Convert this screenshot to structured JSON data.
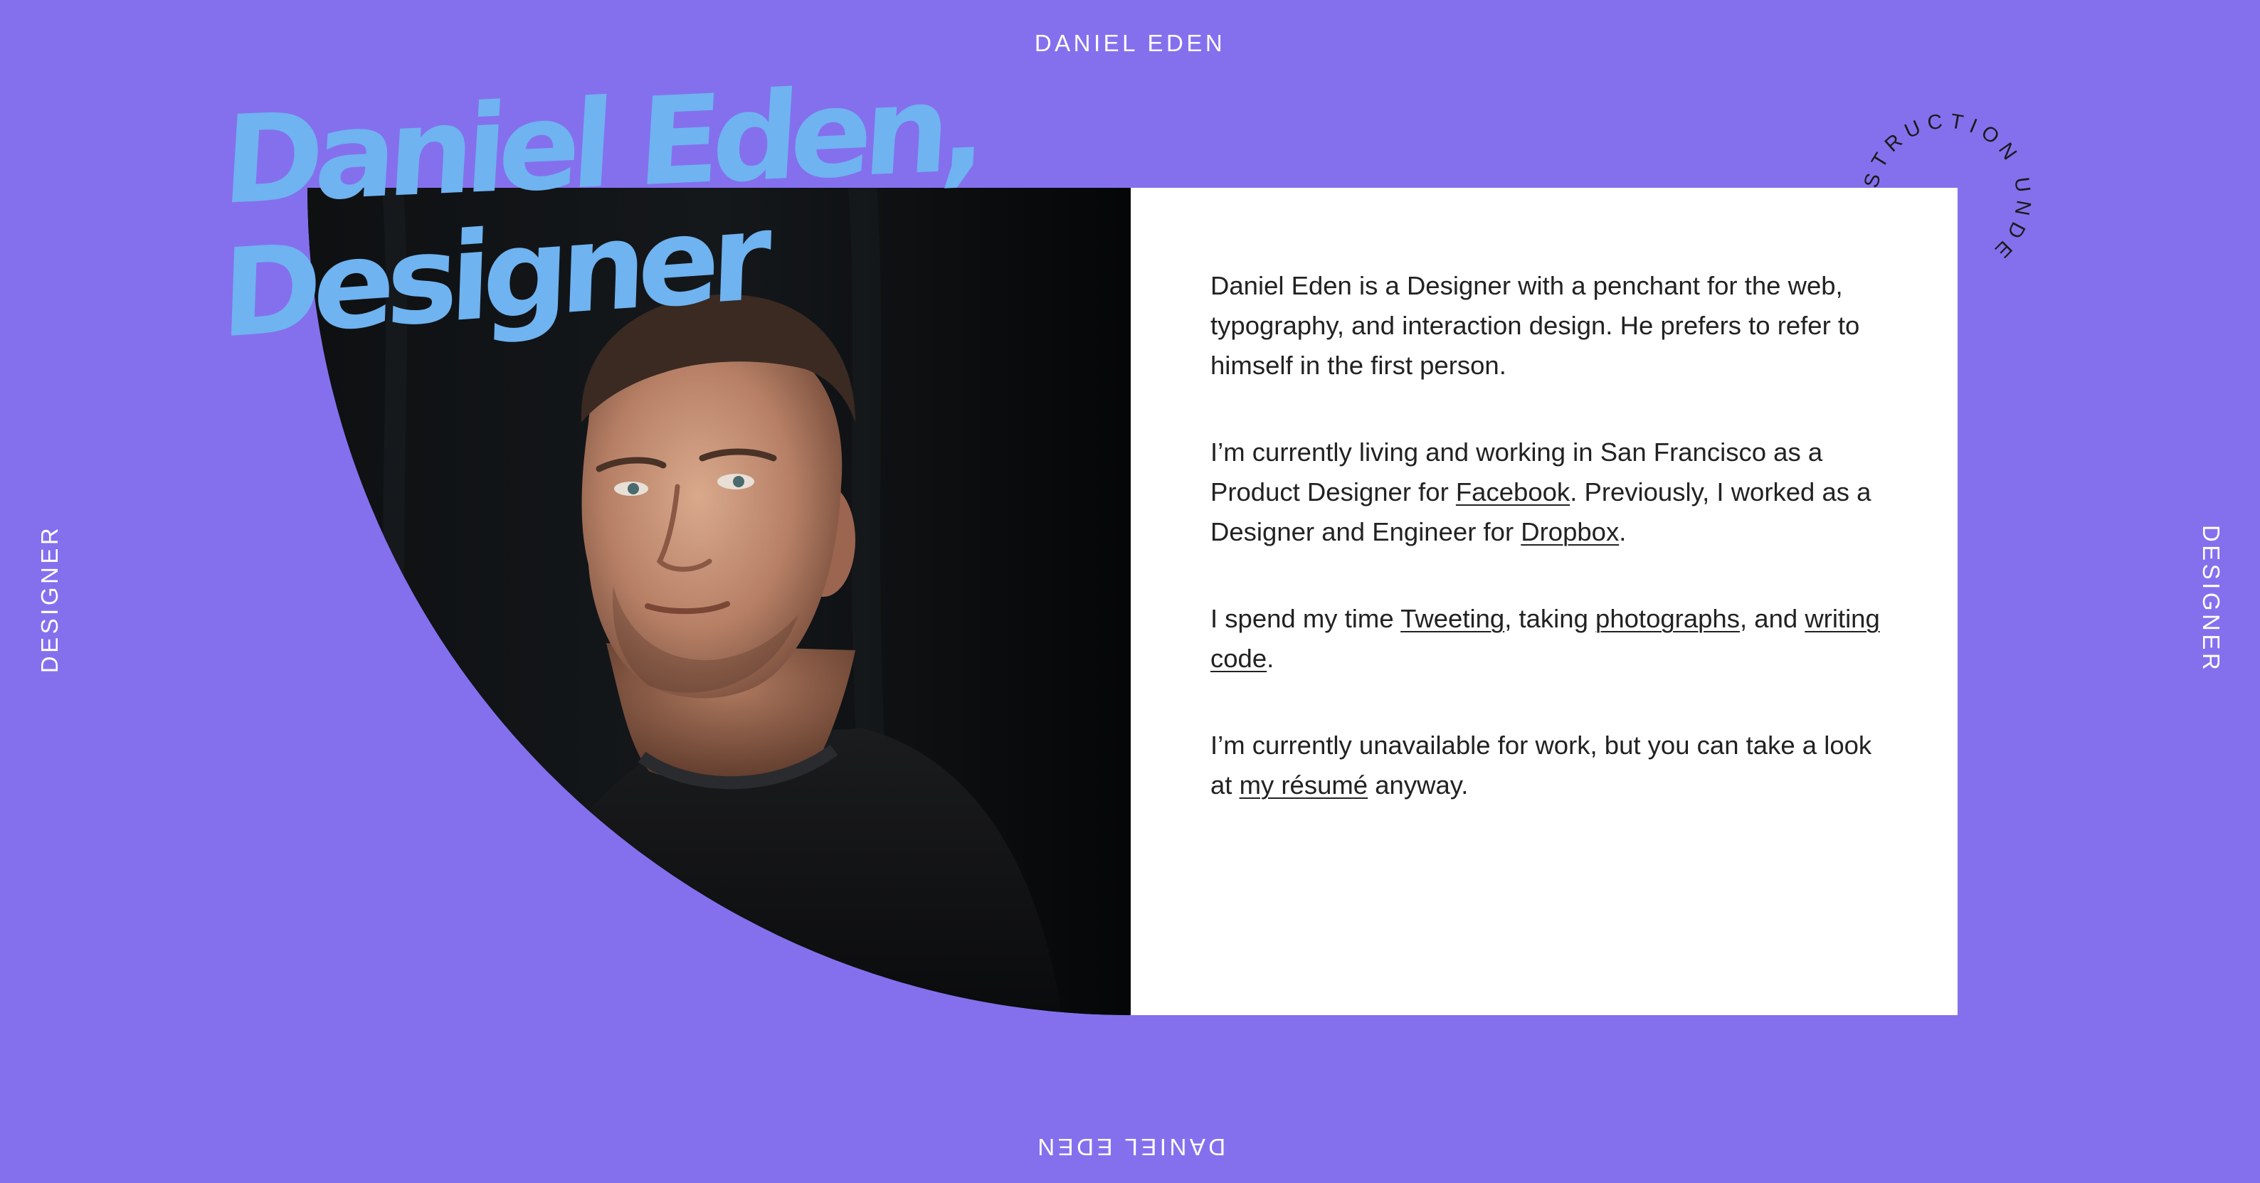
{
  "edges": {
    "top": "DANIEL EDEN",
    "bottom": "DANIEL EDEN",
    "left": "DESIGNER",
    "right": "DESIGNER"
  },
  "headline": {
    "line1": "Daniel Eden,",
    "line2": "Designer"
  },
  "badge": {
    "text": "STRUCTION UNDE"
  },
  "bio": {
    "p1": "Daniel Eden is a Designer with a penchant for the web, typography, and interaction design. He prefers to refer to himself in the first person.",
    "p2": {
      "t1": "I’m currently living and working in San Francisco as a Product Designer for ",
      "link1": "Facebook",
      "t2": ". Previously, I worked as a Designer and Engineer for ",
      "link2": "Dropbox",
      "t3": "."
    },
    "p3": {
      "t1": "I spend my time ",
      "link1": "Tweeting",
      "t2": ", taking ",
      "link2": "photographs",
      "t3": ", and ",
      "link3": "writing code",
      "t4": "."
    },
    "p4": {
      "t1": "I’m currently unavailable for work, but you can take a look at ",
      "link1": "my résumé",
      "t2": " anyway."
    }
  },
  "colors": {
    "background": "#8470ED",
    "headline": "#6FB3F0",
    "card": "#FFFFFF",
    "text": "#222222",
    "photo_backdrop": "#0B0D0F"
  }
}
